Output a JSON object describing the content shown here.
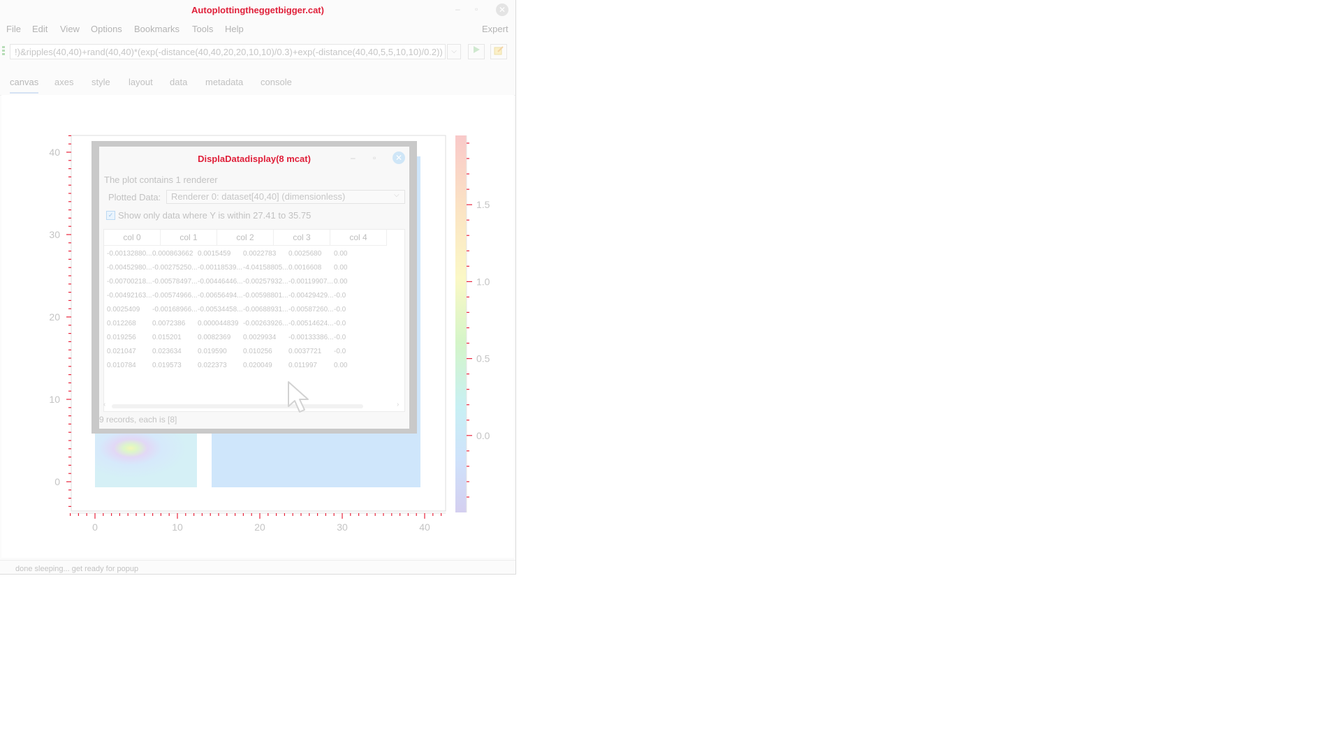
{
  "window": {
    "title": "Autoplottingtheggetbigger.cat)",
    "minimize": "–",
    "maximize": "▫",
    "close": "✕"
  },
  "menu": [
    "File",
    "Edit",
    "View",
    "Options",
    "Bookmarks",
    "Tools",
    "Help"
  ],
  "menu_right": "Expert",
  "toolbar": {
    "command": "!)&ripples(40,40)+rand(40,40)*(exp(-distance(40,40,20,20,10,10)/0.3)+exp(-distance(40,40,5,5,10,10)/0.2))",
    "dropdown": "⌵",
    "run_icon": "play-icon",
    "edit_icon": "edit-icon"
  },
  "tabs": [
    "canvas",
    "axes",
    "style",
    "layout",
    "data",
    "metadata",
    "console"
  ],
  "status": "done sleeping... get ready for popup",
  "chart_data": {
    "type": "heatmap",
    "x_ticks": [
      "0",
      "10",
      "20",
      "30",
      "40"
    ],
    "y_ticks": [
      "0",
      "10",
      "20",
      "30",
      "40"
    ],
    "colorbar_ticks": [
      "1.5",
      "1.0",
      "0.5",
      "0.0"
    ],
    "xlim": [
      -3,
      42
    ],
    "ylim": [
      -3,
      42
    ],
    "colorbar_range": [
      -0.5,
      1.95
    ],
    "grid": false
  },
  "dialog": {
    "title": "DisplaDatadisplay(8 mcat)",
    "info": "The plot contains 1 renderer",
    "plotted_label": "Plotted Data:",
    "plotted_value": "Renderer 0: dataset[40,40] (dimensionless)",
    "checkbox_label": "Show only data where Y is within 27.41 to 35.75",
    "columns": [
      "col 0",
      "col 1",
      "col 2",
      "col 3",
      "col 4"
    ],
    "rows": [
      [
        "-0.00132880...",
        "0.000863662",
        "0.0015459",
        "0.0022783",
        "0.0025680",
        "0.00"
      ],
      [
        "-0.00452980...",
        "-0.00275250...",
        "-0.00118539...",
        "-4.04158805...",
        "0.0016608",
        "0.00"
      ],
      [
        "-0.00700218...",
        "-0.00578497...",
        "-0.00446446...",
        "-0.00257932...",
        "-0.00119907...",
        "0.00"
      ],
      [
        "-0.00492163...",
        "-0.00574966...",
        "-0.00656494...",
        "-0.00598801...",
        "-0.00429429...",
        "-0.0"
      ],
      [
        "0.0025409",
        "-0.00168966...",
        "-0.00534458...",
        "-0.00688931...",
        "-0.00587260...",
        "-0.0"
      ],
      [
        "0.012268",
        "0.0072386",
        "0.000044839",
        "-0.00263926...",
        "-0.00514624...",
        "-0.0"
      ],
      [
        "0.019256",
        "0.015201",
        "0.0082369",
        "0.0029934",
        "-0.00133386...",
        "-0.0"
      ],
      [
        "0.021047",
        "0.023634",
        "0.019590",
        "0.010256",
        "0.0037721",
        "-0.0"
      ],
      [
        "0.010784",
        "0.019573",
        "0.022373",
        "0.020049",
        "0.011997",
        "0.00"
      ]
    ],
    "footer": "9 records, each is [8]"
  }
}
